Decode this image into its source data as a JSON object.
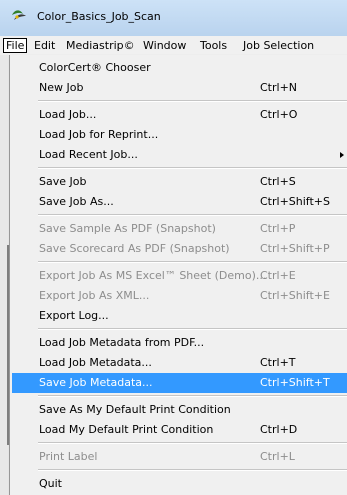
{
  "window": {
    "title": "Color_Basics_Job_Scan"
  },
  "menubar": {
    "items": [
      {
        "label": "File"
      },
      {
        "label": "Edit"
      },
      {
        "label": "Mediastrip©"
      },
      {
        "label": "Window"
      },
      {
        "label": "Tools"
      },
      {
        "label": "Job Selection"
      }
    ]
  },
  "file_menu": {
    "items": [
      {
        "label": "ColorCert® Chooser",
        "shortcut": ""
      },
      {
        "label": "New Job",
        "shortcut": "Ctrl+N"
      },
      {
        "label": "Load Job...",
        "shortcut": "Ctrl+O"
      },
      {
        "label": "Load Job for Reprint...",
        "shortcut": ""
      },
      {
        "label": "Load Recent Job...",
        "shortcut": ""
      },
      {
        "label": "Save Job",
        "shortcut": "Ctrl+S"
      },
      {
        "label": "Save Job As...",
        "shortcut": "Ctrl+Shift+S"
      },
      {
        "label": "Save Sample As PDF (Snapshot)",
        "shortcut": "Ctrl+P"
      },
      {
        "label": "Save Scorecard As PDF (Snapshot)",
        "shortcut": "Ctrl+Shift+P"
      },
      {
        "label": "Export Job As MS Excel™ Sheet (Demo)...",
        "shortcut": "Ctrl+E"
      },
      {
        "label": "Export Job As XML...",
        "shortcut": "Ctrl+Shift+E"
      },
      {
        "label": "Export Log...",
        "shortcut": ""
      },
      {
        "label": "Load Job Metadata from PDF...",
        "shortcut": ""
      },
      {
        "label": "Load Job Metadata...",
        "shortcut": "Ctrl+T"
      },
      {
        "label": "Save Job Metadata...",
        "shortcut": "Ctrl+Shift+T"
      },
      {
        "label": "Save As My Default Print Condition",
        "shortcut": ""
      },
      {
        "label": "Load My Default Print Condition",
        "shortcut": "Ctrl+D"
      },
      {
        "label": "Print Label",
        "shortcut": "Ctrl+L"
      },
      {
        "label": "Quit",
        "shortcut": ""
      }
    ]
  },
  "colors": {
    "highlight": "#3399ff",
    "disabled_text": "#8d8d8d",
    "titlebar": "#c5dcf4"
  }
}
